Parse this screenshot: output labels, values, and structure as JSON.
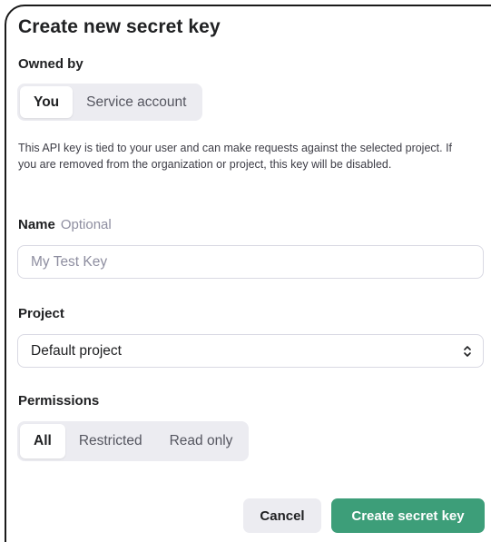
{
  "modal": {
    "title": "Create new secret key"
  },
  "owned_by": {
    "label": "Owned by",
    "options": [
      "You",
      "Service account"
    ],
    "selected": "You"
  },
  "description": "This API key is tied to your user and can make requests against the selected project. If you are removed from the organization or project, this key will be disabled.",
  "name_field": {
    "label": "Name",
    "hint": "Optional",
    "placeholder": "My Test Key",
    "value": ""
  },
  "project": {
    "label": "Project",
    "selected": "Default project"
  },
  "permissions": {
    "label": "Permissions",
    "options": [
      "All",
      "Restricted",
      "Read only"
    ],
    "selected": "All"
  },
  "actions": {
    "cancel_label": "Cancel",
    "create_label": "Create secret key"
  },
  "colors": {
    "accent": "#3d9e79",
    "segment_bg": "#ececf1",
    "border": "#d9d9e3"
  },
  "icons": {
    "project_select": "chevron-up-down-icon"
  }
}
